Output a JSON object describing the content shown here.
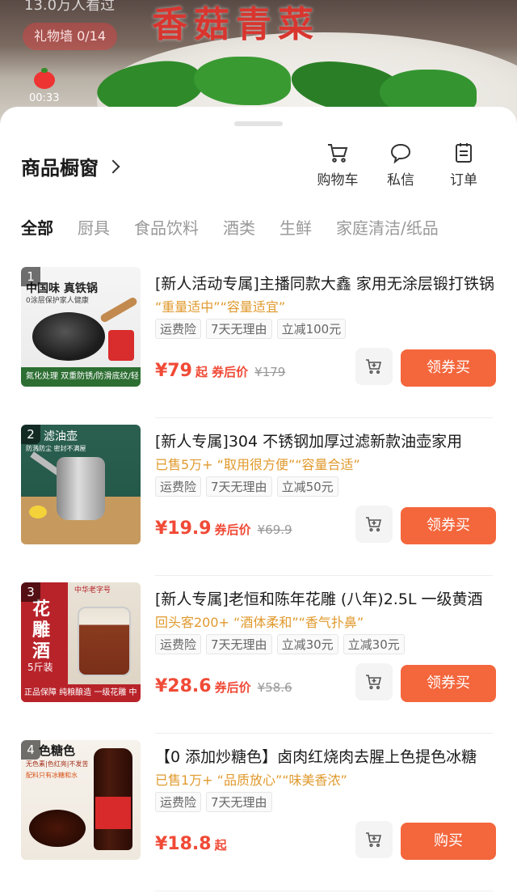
{
  "video": {
    "overlay_text": "13.0万人看过",
    "dish_title": "香菇青菜",
    "gift_wall": "礼物墙 0/14",
    "timecode": "00:33"
  },
  "shop": {
    "title": "商品橱窗",
    "actions": [
      {
        "label": "购物车",
        "icon": "cart-icon"
      },
      {
        "label": "私信",
        "icon": "message-icon"
      },
      {
        "label": "订单",
        "icon": "order-icon"
      }
    ],
    "tabs": [
      "全部",
      "厨具",
      "食品饮料",
      "酒类",
      "生鲜",
      "家庭清洁/纸品"
    ],
    "active_tab": "全部"
  },
  "products": [
    {
      "rank": "1",
      "title": "[新人活动专属]主播同款大鑫 家用无涂层锻打铁锅",
      "subtitle": "“重量适中”“容量适宜”",
      "tags": [
        "运费险",
        "7天无理由",
        "立减100元"
      ],
      "price": "¥79",
      "price_suffix": "起 券后价",
      "old_price": "¥179",
      "button": "领券买",
      "thumb_caption": "中国味 真铁锅",
      "thumb_caption2": "0涂层保护家人健康",
      "thumb_badge": "氮化处理 双重防锈/防滑底纹/轻便款"
    },
    {
      "rank": "2",
      "title": "[新人专属]304 不锈钢加厚过滤新款油壶家用",
      "subtitle": "已售5万+ “取用很方便”“容量合适”",
      "tags": [
        "运费险",
        "7天无理由",
        "立减50元"
      ],
      "price": "¥19.9",
      "price_suffix": "券后价",
      "old_price": "¥69.9",
      "button": "领券买",
      "thumb_caption": "滤油壶",
      "thumb_caption2": "防溅防尘 密封不满屋"
    },
    {
      "rank": "3",
      "title": "[新人专属]老恒和陈年花雕 (八年)2.5L 一级黄酒",
      "subtitle": "回头客200+ “酒体柔和”“香气扑鼻”",
      "tags": [
        "运费险",
        "7天无理由",
        "立减30元",
        "立减30元"
      ],
      "price": "¥28.6",
      "price_suffix": "券后价",
      "old_price": "¥58.6",
      "button": "领券买",
      "thumb_caption": "花雕酒",
      "thumb_caption2": "5斤装",
      "thumb_top": "中华老字号",
      "thumb_bottom": "正品保障 纯粮酿造 一级花雕 中华老字号 百年品牌"
    },
    {
      "rank": "4",
      "title": "【0 添加炒糖色】卤肉红烧肉去腥上色提色冰糖",
      "subtitle": "已售1万+ “品质放心”“味美香浓”",
      "tags": [
        "运费险",
        "7天无理由"
      ],
      "price": "¥18.8",
      "price_suffix": "起",
      "old_price": "",
      "button": "购买",
      "thumb_caption": "色糖色",
      "thumb_caption2": "无色素|色红亮|不发苦",
      "thumb_caption3": "配料只有冰糖和水"
    }
  ],
  "colors": {
    "accent": "#f4663c",
    "price": "#f04a36",
    "subtitle": "#e09a2e"
  }
}
